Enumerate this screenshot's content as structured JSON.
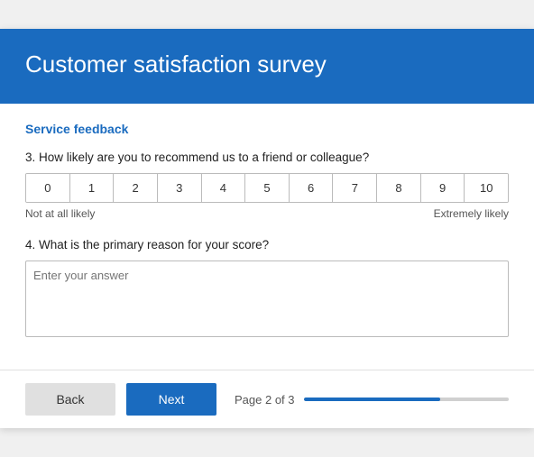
{
  "header": {
    "title": "Customer satisfaction survey"
  },
  "section": {
    "label": "Service feedback"
  },
  "question3": {
    "label": "3. How likely are you to recommend us to a friend or colleague?",
    "scale": [
      "0",
      "1",
      "2",
      "3",
      "4",
      "5",
      "6",
      "7",
      "8",
      "9",
      "10"
    ],
    "low_label": "Not at all likely",
    "high_label": "Extremely likely"
  },
  "question4": {
    "label": "4. What is the primary reason for your score?",
    "placeholder": "Enter your answer"
  },
  "footer": {
    "back_label": "Back",
    "next_label": "Next",
    "page_label": "Page 2 of 3",
    "progress_pct": 66.67
  }
}
